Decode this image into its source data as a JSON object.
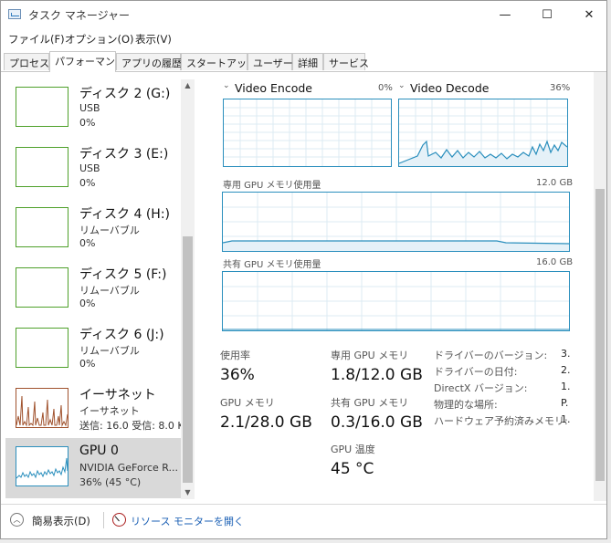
{
  "window": {
    "title": "タスク マネージャー",
    "controls": {
      "minimize": "—",
      "maximize": "☐",
      "close": "✕"
    }
  },
  "menu": [
    "ファイル(F)",
    "オプション(O)",
    "表示(V)"
  ],
  "tabs": [
    "プロセス",
    "パフォーマンス",
    "アプリの履歴",
    "スタートアップ",
    "ユーザー",
    "詳細",
    "サービス"
  ],
  "active_tab": "パフォーマンス",
  "sidebar": {
    "items": [
      {
        "name": "ディスク 2 (G:)",
        "sub1": "USB",
        "sub2": "0%"
      },
      {
        "name": "ディスク 3 (E:)",
        "sub1": "USB",
        "sub2": "0%"
      },
      {
        "name": "ディスク 4 (H:)",
        "sub1": "リムーバブル",
        "sub2": "0%"
      },
      {
        "name": "ディスク 5 (F:)",
        "sub1": "リムーバブル",
        "sub2": "0%"
      },
      {
        "name": "ディスク 6 (J:)",
        "sub1": "リムーバブル",
        "sub2": "0%"
      },
      {
        "name": "イーサネット",
        "sub1": "イーサネット",
        "sub2": "送信: 16.0 受信: 8.0 K"
      },
      {
        "name": "GPU 0",
        "sub1": "NVIDIA GeForce R...",
        "sub2": "36% (45 °C)"
      }
    ],
    "selected": "GPU 0"
  },
  "gpu": {
    "video_encode": {
      "title": "Video Encode",
      "value": "0%"
    },
    "video_decode": {
      "title": "Video Decode",
      "value": "36%"
    },
    "dedicated_mem_graph": {
      "label": "専用 GPU メモリ使用量",
      "max": "12.0 GB",
      "level": 0.07
    },
    "shared_mem_graph": {
      "label": "共有 GPU メモリ使用量",
      "max": "16.0 GB"
    },
    "stats": {
      "usage_label": "使用率",
      "usage_value": "36%",
      "gpu_mem_label": "GPU メモリ",
      "gpu_mem_value": "2.1/28.0 GB",
      "dedicated_label": "専用 GPU メモリ",
      "dedicated_value": "1.8/12.0 GB",
      "shared_label": "共有 GPU メモリ",
      "shared_value": "0.3/16.0 GB",
      "temp_label": "GPU 温度",
      "temp_value": "45 °C"
    },
    "details": [
      {
        "key": "ドライバーのバージョン:",
        "value": "3."
      },
      {
        "key": "ドライバーの日付:",
        "value": "2."
      },
      {
        "key": "DirectX バージョン:",
        "value": "1."
      },
      {
        "key": "物理的な場所:",
        "value": "P."
      },
      {
        "key": "ハードウェア予約済みメモリ:",
        "value": "1."
      }
    ]
  },
  "footer": {
    "fewer_details": "簡易表示(D)",
    "resource_monitor": "リソース モニターを開く"
  },
  "colors": {
    "gpu_graph": "#2b8fbd",
    "disk_graph": "#4ea02a",
    "net_graph": "#a0522d"
  }
}
